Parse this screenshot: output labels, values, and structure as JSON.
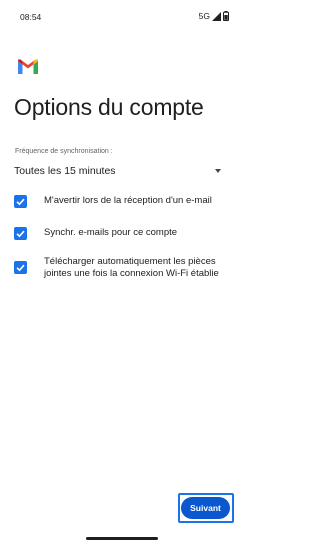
{
  "status_bar": {
    "time": "08:54",
    "network": "5G",
    "icons": [
      "signal-icon",
      "battery-icon"
    ]
  },
  "app": {
    "logo": "gmail-logo",
    "brand_colors": [
      "#4285f4",
      "#ea4335",
      "#fbbc04",
      "#34a853"
    ]
  },
  "page": {
    "title": "Options du compte"
  },
  "sync": {
    "label": "Fréquence de synchronisation :",
    "selected": "Toutes les 15 minutes"
  },
  "options": [
    {
      "line1": "M'avertir lors de la réception d'un e-mail",
      "line2": "",
      "checked": true
    },
    {
      "line1": "Synchr. e-mails pour ce compte",
      "line2": "",
      "checked": true
    },
    {
      "line1": "Télécharger automatiquement les pièces",
      "line2": "jointes une fois la connexion Wi-Fi établie",
      "checked": true
    }
  ],
  "footer": {
    "next_label": "Suivant"
  },
  "colors": {
    "accent": "#1a73e8",
    "button": "#0b57d0"
  }
}
